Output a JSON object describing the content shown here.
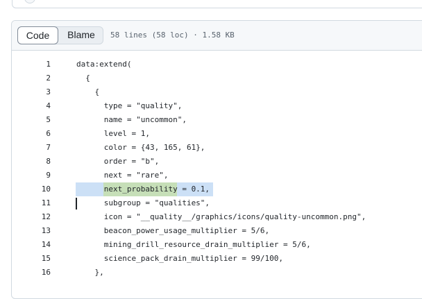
{
  "header": {
    "tabs": [
      {
        "label": "Code"
      },
      {
        "label": "Blame"
      }
    ],
    "file_info": "58 lines (58 loc) · 1.58 KB"
  },
  "code": {
    "lines": [
      {
        "number": "1",
        "text": "data:extend("
      },
      {
        "number": "2",
        "text": "  {"
      },
      {
        "number": "3",
        "text": "    {"
      },
      {
        "number": "4",
        "text": "      type = \"quality\","
      },
      {
        "number": "5",
        "text": "      name = \"uncommon\","
      },
      {
        "number": "6",
        "text": "      level = 1,"
      },
      {
        "number": "7",
        "text": "      color = {43, 165, 61},"
      },
      {
        "number": "8",
        "text": "      order = \"b\","
      },
      {
        "number": "9",
        "text": "      next = \"rare\","
      },
      {
        "number": "10",
        "text": "      next_probability = 0.1,"
      },
      {
        "number": "11",
        "text": "      subgroup = \"qualities\","
      },
      {
        "number": "12",
        "text": "      icon = \"__quality__/graphics/icons/quality-uncommon.png\","
      },
      {
        "number": "13",
        "text": "      beacon_power_usage_multiplier = 5/6,"
      },
      {
        "number": "14",
        "text": "      mining_drill_resource_drain_multiplier = 5/6,"
      },
      {
        "number": "15",
        "text": "      science_pack_drain_multiplier = 99/100,"
      },
      {
        "number": "16",
        "text": "    },"
      }
    ],
    "selected_line": "10",
    "caret_line": "11"
  },
  "colors": {
    "selection": "#cce0f6",
    "word_highlight": "#c6dfb8",
    "border": "#d1d9e0",
    "header_bg": "#f6f8fa"
  }
}
